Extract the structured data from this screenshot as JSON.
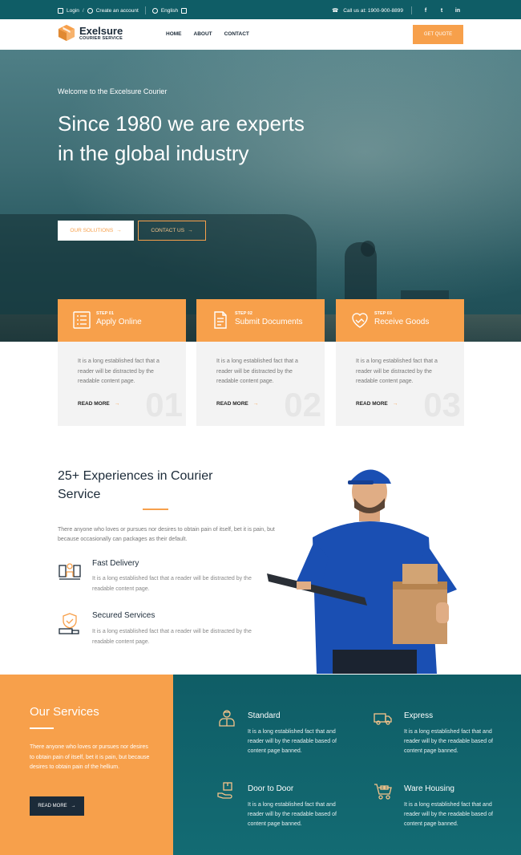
{
  "colors": {
    "primary": "#0f5d66",
    "accent": "#f7a04b",
    "dark": "#1c2b39"
  },
  "topbar": {
    "login": "Login",
    "separator": "/",
    "create": "Create an account",
    "language": "English",
    "call": "Call us at: 1900-900-8899",
    "social": [
      "f",
      "t",
      "in"
    ]
  },
  "nav": {
    "brand": "Exelsure",
    "brand_sub": "COURIER SERVICE",
    "menu": [
      "HOME",
      "ABOUT",
      "CONTACT"
    ],
    "quote": "GET QUOTE"
  },
  "hero": {
    "welcome": "Welcome to the Excelsure Courier",
    "title": "Since 1980 we are experts in the global industry",
    "btn_solutions": "OUR SOLUTIONS",
    "btn_contact": "CONTACT US"
  },
  "steps": [
    {
      "no": "STEP 01",
      "title": "Apply Online",
      "text": "It is a long established fact that a reader will be distracted by the readable content page.",
      "read": "READ MORE",
      "big": "01",
      "icon": "list-icon"
    },
    {
      "no": "STEP 02",
      "title": "Submit Documents",
      "text": "It is a long established fact that a reader will be distracted by the readable content page.",
      "read": "READ MORE",
      "big": "02",
      "icon": "document-icon"
    },
    {
      "no": "STEP 03",
      "title": "Receive Goods",
      "text": "It is a long established fact that a reader will be distracted by the readable content page.",
      "read": "READ MORE",
      "big": "03",
      "icon": "handshake-icon"
    }
  ],
  "experience": {
    "title": "25+ Experiences in Courier Service",
    "desc": "There anyone who loves or pursues nor desires to obtain pain of itself, bet it is pain, but because occasionally can packages as their default.",
    "features": [
      {
        "title": "Fast Delivery",
        "text": "It is a long established fact that a reader will be distracted by the readable content page.",
        "icon": "delivery-icon"
      },
      {
        "title": "Secured Services",
        "text": "It is a long established fact that a reader will be distracted by the readable content page.",
        "icon": "shield-truck-icon"
      }
    ]
  },
  "services": {
    "title": "Our Services",
    "desc": "There anyone who loves or pursues nor desires to obtain pain of itself, bet it is pain, but because desires to obtain pain of the hellium.",
    "button": "READ MORE",
    "items": [
      {
        "title": "Standard",
        "text": "It is a long established fact that and reader will by the readable based of content page banned.",
        "icon": "worker-icon"
      },
      {
        "title": "Express",
        "text": "It is a long established fact that and reader will by the readable based of content page banned.",
        "icon": "truck-icon"
      },
      {
        "title": "Door to Door",
        "text": "It is a long established fact that and reader will by the readable based of content page banned.",
        "icon": "box-hand-icon"
      },
      {
        "title": "Ware Housing",
        "text": "It is a long established fact that and reader will by the readable based of content page banned.",
        "icon": "warehouse-cart-icon"
      }
    ]
  }
}
